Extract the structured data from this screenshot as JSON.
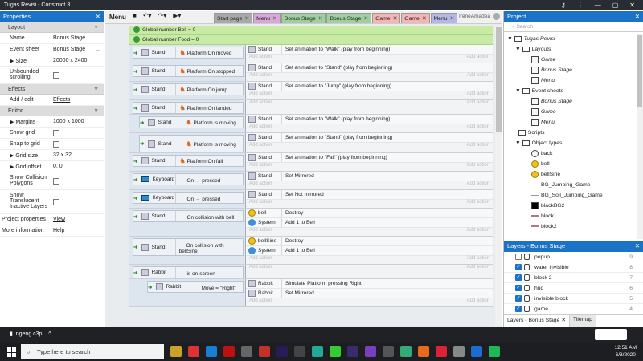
{
  "window": {
    "title": "Tugas Revisi - Construct 3"
  },
  "properties": {
    "title": "Properties",
    "sections": {
      "layout": "Layout",
      "effects": "Effects",
      "editor": "Editor"
    },
    "name_k": "Name",
    "name_v": "Bonus Stage",
    "sheet_k": "Event sheet",
    "sheet_v": "Bonus Stage",
    "size_k": "Size",
    "size_v": "20000 x 2400",
    "unb_k": "Unbounded scrolling",
    "addedit_k": "Add / edit",
    "addedit_v": "Effects",
    "margins_k": "Margins",
    "margins_v": "1000 x 1000",
    "showgrid_k": "Show grid",
    "snap_k": "Snap to grid",
    "gridsize_k": "Grid size",
    "gridsize_v": "32 x 32",
    "gridoff_k": "Grid offset",
    "gridoff_v": "0, 0",
    "showcoll_k": "Show Collision Polygons",
    "showtrans_k": "Show Translucent Inactive Layers",
    "projprops_k": "Project properties",
    "projprops_v": "View",
    "moreinfo_k": "More information",
    "moreinfo_v": "Help"
  },
  "toolbar": {
    "menu": "Menu",
    "user": "IreneAmadea"
  },
  "tabs": [
    "Start page",
    "Menu",
    "Bonus Stage",
    "Bonus Stage",
    "Game",
    "Game",
    "Menu"
  ],
  "globals": [
    "Global number Bell = 0",
    "Global number Food = 0"
  ],
  "events": [
    {
      "n": "1",
      "obj": "Stand",
      "cond": "Platform On moved",
      "aobj": "Stand",
      "act": "Set animation to \"Walk\" (play from beginning)"
    },
    {
      "n": "2",
      "obj": "Stand",
      "cond": "Platform On stopped",
      "aobj": "Stand",
      "act": "Set animation to \"Stand\" (play from beginning)"
    },
    {
      "n": "3",
      "obj": "Stand",
      "cond": "Platform On jump",
      "aobj": "Stand",
      "act": "Set animation to \"Jump\" (play from beginning)"
    },
    {
      "n": "4",
      "obj": "Stand",
      "cond": "Platform On landed",
      "aobj": "",
      "act": ""
    },
    {
      "n": "5",
      "obj": "Stand",
      "cond": "Platform is moving",
      "aobj": "Stand",
      "act": "Set animation to \"Walk\" (play from beginning)"
    },
    {
      "n": "6",
      "obj": "Stand",
      "cond": "Platform is moving",
      "aobj": "Stand",
      "act": "Set animation to \"Stand\" (play from beginning)"
    },
    {
      "n": "7",
      "obj": "Stand",
      "cond": "Platform On fall",
      "aobj": "Stand",
      "act": "Set animation to \"Fall\" (play from beginning)"
    },
    {
      "n": "8",
      "obj": "Keyboard",
      "cond": "On ← pressed",
      "aobj": "Stand",
      "act": "Set Mirrored"
    },
    {
      "n": "9",
      "obj": "Keyboard",
      "cond": "On → pressed",
      "aobj": "Stand",
      "act": "Set Not mirrored"
    },
    {
      "n": "10",
      "obj": "Stand",
      "cond": "On collision with bell",
      "aobj": "bell",
      "act": "Destroy",
      "aobj2": "System",
      "act2": "Add 1 to Bell"
    },
    {
      "n": "11",
      "obj": "Stand",
      "cond": "On collision with bellSine",
      "aobj": "bellSine",
      "act": "Destroy",
      "aobj2": "System",
      "act2": "Add 1 to Bell"
    },
    {
      "n": "12",
      "obj": "Rabbit",
      "cond": "is on-screen",
      "aobj": "",
      "act": ""
    },
    {
      "n": "13",
      "obj": "Rabbit",
      "cond": "Move = \"Right\"",
      "aobj": "Rabbit",
      "act": "Simulate Platform pressing Right",
      "aobj2": "Rabbit",
      "act2": "Set Mirrored"
    }
  ],
  "add_action": "Add action",
  "project": {
    "title": "Project",
    "search": "Search",
    "root": "Tugas Revisi",
    "layouts": "Layouts",
    "layout_items": [
      "Game",
      "Bonus Stage",
      "Menu"
    ],
    "eventsheets": "Event sheets",
    "sheet_items": [
      "Bonus Stage",
      "Game",
      "Menu"
    ],
    "scripts": "Scripts",
    "objtypes": "Object types",
    "objects": [
      "back",
      "bell",
      "bellSine",
      "BG_Jumping_Game",
      "BG_Soil_Jumping_Game",
      "blackBG2",
      "block",
      "block2"
    ]
  },
  "layers": {
    "title": "Layers - Bonus Stage",
    "rows": [
      {
        "name": "popup",
        "n": "9"
      },
      {
        "name": "water invisible",
        "n": "8"
      },
      {
        "name": "block 2",
        "n": "7"
      },
      {
        "name": "hud",
        "n": "6"
      },
      {
        "name": "invisible block",
        "n": "5"
      },
      {
        "name": "game",
        "n": "4"
      }
    ],
    "tab1": "Layers - Bonus Stage",
    "tab2": "Tilemap"
  },
  "download": {
    "file": "ngeng.c3p"
  },
  "taskbar": {
    "search": "Type here to search",
    "time": "12:51 AM",
    "date": "6/3/2020"
  }
}
